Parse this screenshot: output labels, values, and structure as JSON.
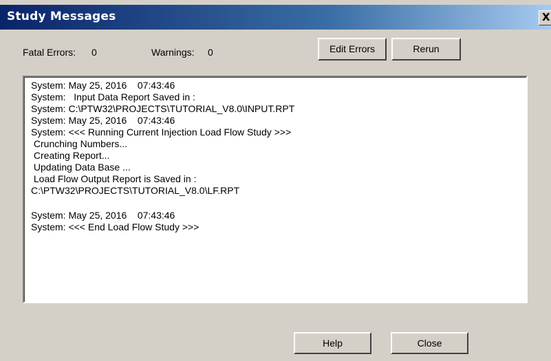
{
  "dialog": {
    "title": "Study Messages",
    "close_glyph": "X"
  },
  "summary": {
    "fatal_errors_label": "Fatal Errors:",
    "fatal_errors_value": "0",
    "warnings_label": "Warnings:",
    "warnings_value": "0"
  },
  "buttons": {
    "edit_errors": "Edit Errors",
    "rerun": "Rerun",
    "help": "Help",
    "close": "Close"
  },
  "messages": [
    "System: May 25, 2016    07:43:46",
    "System:   Input Data Report Saved in :",
    "System: C:\\PTW32\\PROJECTS\\TUTORIAL_V8.0\\INPUT.RPT",
    "System: May 25, 2016    07:43:46",
    "System: <<< Running Current Injection Load Flow Study >>>",
    " Crunching Numbers...",
    " Creating Report...",
    " Updating Data Base ...",
    " Load Flow Output Report is Saved in :",
    "C:\\PTW32\\PROJECTS\\TUTORIAL_V8.0\\LF.RPT",
    "",
    "System: May 25, 2016    07:43:46",
    "System: <<< End Load Flow Study >>>"
  ]
}
